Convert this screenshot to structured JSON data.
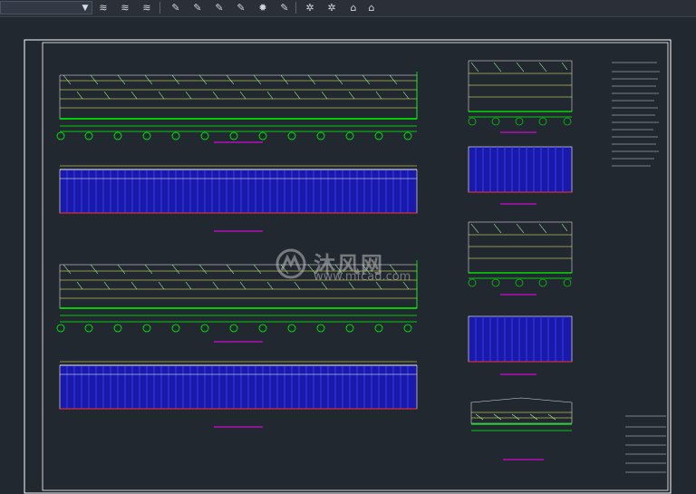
{
  "toolbar": {
    "icons": [
      "layer-tool-1",
      "layer-tool-2",
      "layer-tool-3",
      "match-prop",
      "layer-isolate",
      "layer-freeze",
      "layer-lock",
      "layer-walk",
      "layer-merge",
      "cursor-tool",
      "snap-tool",
      "lock-tool",
      "unlock-tool"
    ]
  },
  "watermark": {
    "brand": "沐风网",
    "url": "www.mfcad.com"
  },
  "colors": {
    "canvas": "#212830",
    "frame": "#ffffff",
    "steel": "#2a2aff",
    "grid": "#00ff00",
    "dim": "#ffff66",
    "magenta": "#ff00ff",
    "red": "#ff3030"
  }
}
